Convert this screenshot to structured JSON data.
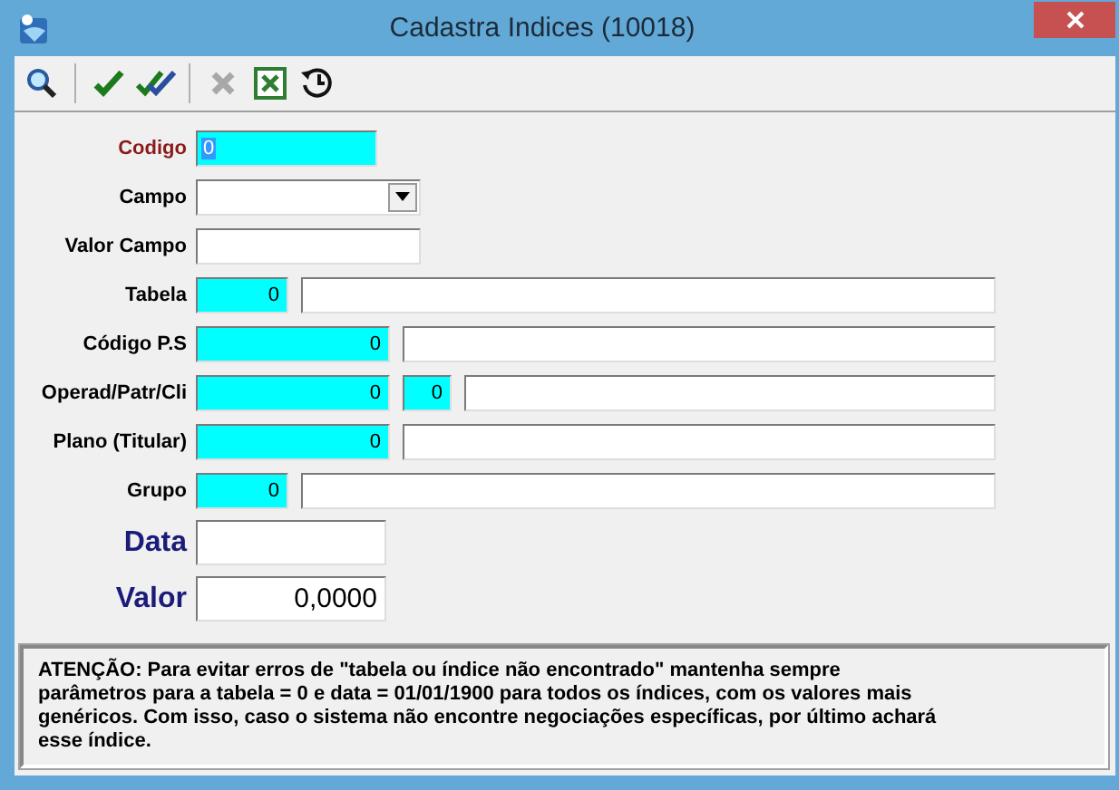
{
  "window": {
    "title": "Cadastra Indices (10018)"
  },
  "toolbar": [
    {
      "kind": "search",
      "disabled": false
    },
    {
      "kind": "separator"
    },
    {
      "kind": "check",
      "disabled": false
    },
    {
      "kind": "double-check",
      "disabled": false
    },
    {
      "kind": "separator"
    },
    {
      "kind": "cancel",
      "disabled": true
    },
    {
      "kind": "excel",
      "disabled": false
    },
    {
      "kind": "history",
      "disabled": false
    }
  ],
  "form": [
    {
      "label": "Codigo",
      "kind": "key",
      "fields": [
        {
          "kind": "input",
          "required": true,
          "value": "0",
          "text_selected": true
        }
      ]
    },
    {
      "label": "Campo",
      "kind": "normal",
      "fields": [
        {
          "kind": "select",
          "required": false
        }
      ]
    },
    {
      "label": "Valor Campo",
      "kind": "normal",
      "fields": [
        {
          "kind": "input",
          "required": false
        }
      ]
    },
    {
      "label": "Tabela",
      "kind": "normal",
      "fields": [
        {
          "kind": "input",
          "required": true,
          "value": "0"
        },
        {
          "kind": "input",
          "required": false
        }
      ]
    },
    {
      "label": "Código P.S",
      "kind": "normal",
      "fields": [
        {
          "kind": "input",
          "required": true,
          "value": "0"
        },
        {
          "kind": "input",
          "required": false
        }
      ]
    },
    {
      "label": "Operad/Patr/Cli",
      "kind": "normal",
      "fields": [
        {
          "kind": "input",
          "required": true,
          "value": "0"
        },
        {
          "kind": "input",
          "required": true,
          "value": "0"
        },
        {
          "kind": "input",
          "required": false
        }
      ]
    },
    {
      "label": "Plano (Titular)",
      "kind": "normal",
      "fields": [
        {
          "kind": "input",
          "required": true,
          "value": "0"
        },
        {
          "kind": "input",
          "required": false
        }
      ]
    },
    {
      "label": "Grupo",
      "kind": "normal",
      "fields": [
        {
          "kind": "input",
          "required": true,
          "value": "0"
        },
        {
          "kind": "input",
          "required": false
        }
      ]
    },
    {
      "label": "Data",
      "kind": "large",
      "fields": [
        {
          "kind": "input",
          "required": false
        }
      ]
    },
    {
      "label": "Valor",
      "kind": "large",
      "fields": [
        {
          "kind": "input",
          "required": false,
          "value": "0,0000"
        }
      ]
    }
  ],
  "notice": "ATENÇÃO: Para evitar erros de \"tabela ou índice não encontrado\" mantenha sempre parâmetros para a tabela = 0 e data = 01/01/1900 para todos os índices, com os valores mais genéricos. Com isso, caso o sistema não encontre negociações específicas, por último achará esse índice."
}
